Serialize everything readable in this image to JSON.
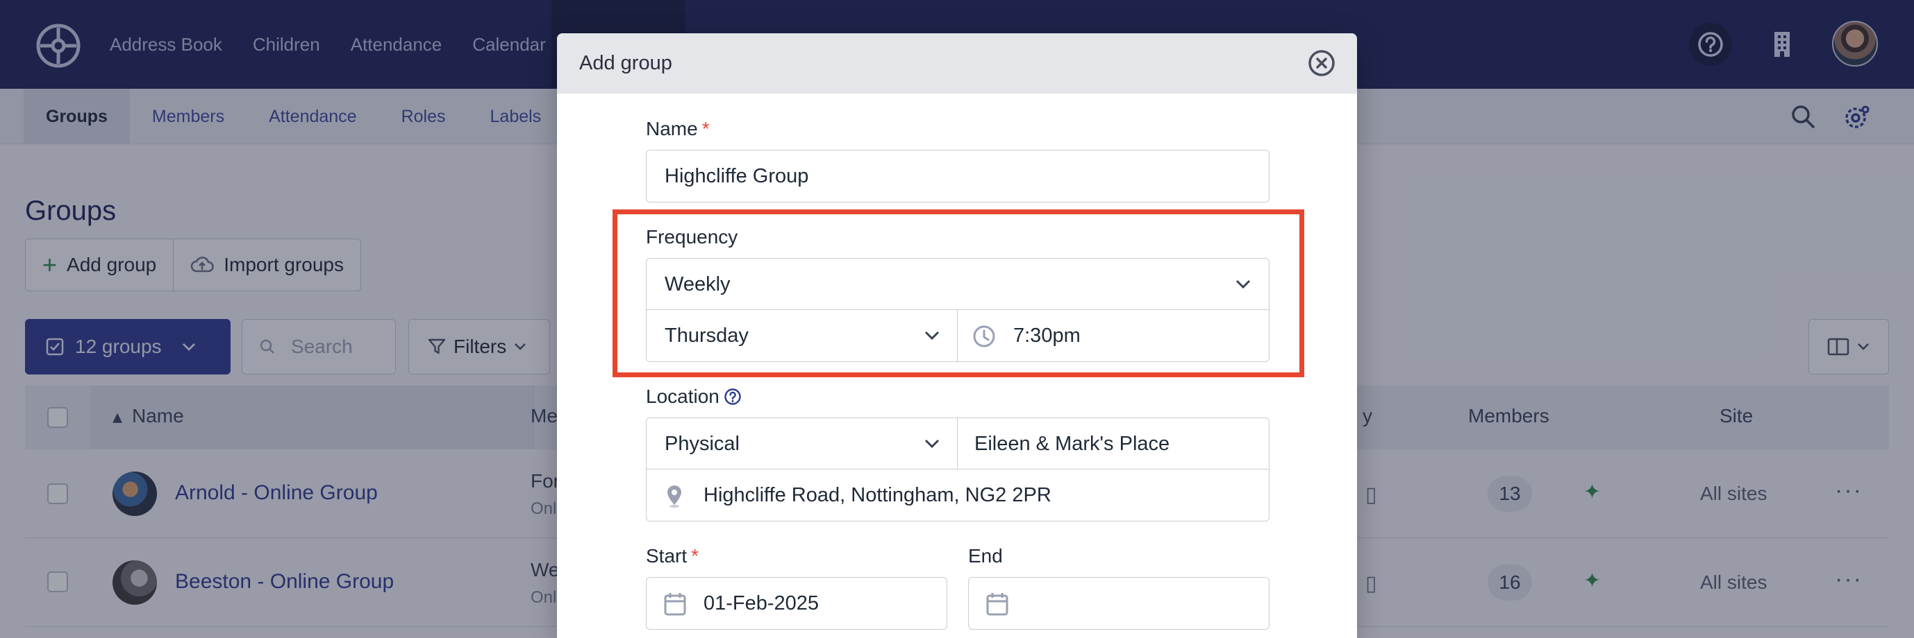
{
  "topnav": {
    "items": [
      "Address Book",
      "Children",
      "Attendance",
      "Calendar"
    ]
  },
  "subnav": {
    "items": [
      "Groups",
      "Members",
      "Attendance",
      "Roles",
      "Labels"
    ]
  },
  "page": {
    "title": "Groups",
    "add_group": "Add group",
    "import_groups": "Import groups",
    "groups_count": "12 groups",
    "search_placeholder": "Search",
    "filters": "Filters"
  },
  "table": {
    "columns": {
      "name": "Name",
      "meeting": "Me",
      "frequency": "y",
      "members": "Members",
      "site": "Site"
    },
    "rows": [
      {
        "name": "Arnold - Online Group",
        "meeting": "For",
        "meeting_sub": "Onl",
        "members": "13",
        "site": "All sites"
      },
      {
        "name": "Beeston - Online Group",
        "meeting": "We",
        "meeting_sub": "Onl",
        "members": "16",
        "site": "All sites"
      }
    ]
  },
  "modal": {
    "title": "Add group",
    "name_label": "Name",
    "required_mark": "*",
    "name_value": "Highcliffe Group",
    "frequency_label": "Frequency",
    "frequency_value": "Weekly",
    "day_value": "Thursday",
    "time_value": "7:30pm",
    "location_label": "Location",
    "location_type": "Physical",
    "location_name": "Eileen & Mark's Place",
    "address": "Highcliffe Road, Nottingham, NG2 2PR",
    "start_label": "Start",
    "start_value": "01-Feb-2025",
    "end_label": "End",
    "end_value": ""
  },
  "colors": {
    "nav": "#1e2356",
    "accent": "#2d3a8c",
    "highlight": "#e8452f",
    "required": "#e5483a"
  }
}
